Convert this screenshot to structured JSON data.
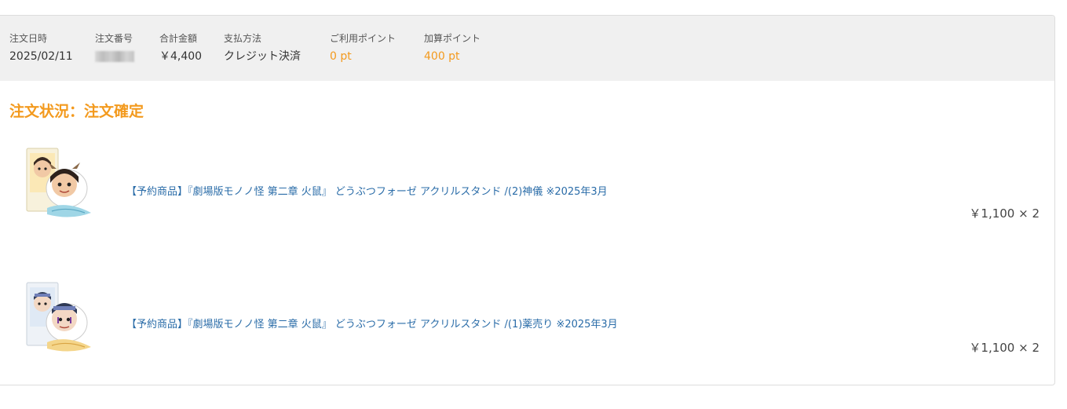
{
  "summary": {
    "order_date": {
      "label": "注文日時",
      "value": "2025/02/11"
    },
    "order_number": {
      "label": "注文番号"
    },
    "total": {
      "label": "合計金額",
      "value": "￥4,400"
    },
    "payment": {
      "label": "支払方法",
      "value": "クレジット決済"
    },
    "used_points": {
      "label": "ご利用ポイント",
      "value": "0 pt"
    },
    "added_points": {
      "label": "加算ポイント",
      "value": "400 pt"
    }
  },
  "status": "注文状況：注文確定",
  "items": [
    {
      "name": "【予約商品】『劇場版モノノ怪 第二章 火鼠』 どうぶつフォーゼ アクリルスタンド /(2)神儀 ※2025年3月",
      "price": "￥1,100 × 2"
    },
    {
      "name": "【予約商品】『劇場版モノノ怪 第二章 火鼠』 どうぶつフォーゼ アクリルスタンド /(1)薬売り ※2025年3月",
      "price": "￥1,100 × 2"
    }
  ],
  "colors": {
    "accent": "#f39a1e",
    "link": "#2a6ca8",
    "summary_bg": "#f0f0f0"
  }
}
